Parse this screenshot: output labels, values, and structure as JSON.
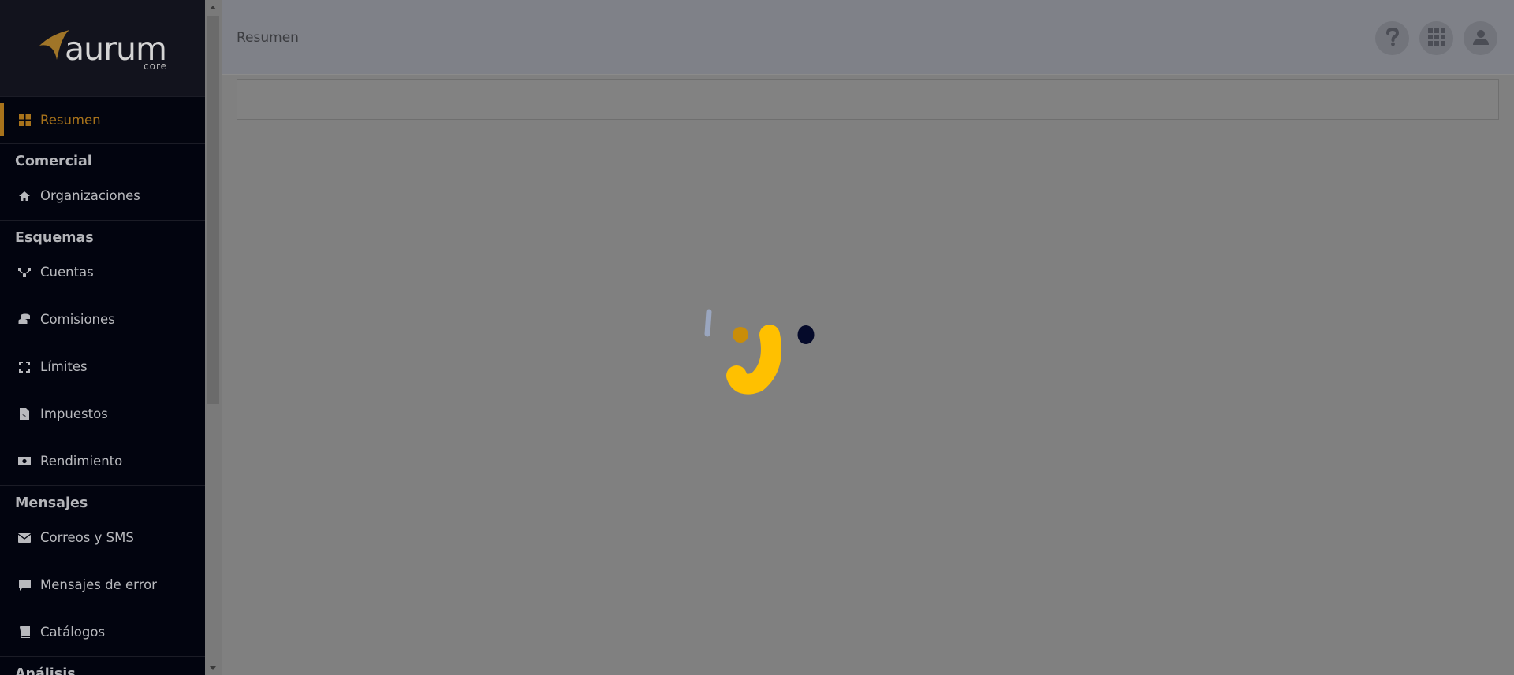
{
  "brand": {
    "name": "aurum",
    "sub": "core"
  },
  "colors": {
    "accent": "#a8731b",
    "sidebar_bg": "#02040f",
    "loader_yellow": "#ffc000",
    "loader_navy": "#050a2a"
  },
  "header": {
    "title": "Resumen"
  },
  "sidebar": {
    "active": {
      "label": "Resumen",
      "icon": "grid-icon"
    },
    "sections": [
      {
        "title": "Comercial",
        "items": [
          {
            "label": "Organizaciones",
            "icon": "home-icon"
          }
        ]
      },
      {
        "title": "Esquemas",
        "items": [
          {
            "label": "Cuentas",
            "icon": "network-icon"
          },
          {
            "label": "Comisiones",
            "icon": "coins-icon"
          },
          {
            "label": "Límites",
            "icon": "expand-icon"
          },
          {
            "label": "Impuestos",
            "icon": "receipt-icon"
          },
          {
            "label": "Rendimiento",
            "icon": "money-icon"
          }
        ]
      },
      {
        "title": "Mensajes",
        "items": [
          {
            "label": "Correos y SMS",
            "icon": "envelope-icon"
          },
          {
            "label": "Mensajes de error",
            "icon": "comment-icon"
          },
          {
            "label": "Catálogos",
            "icon": "book-icon"
          }
        ]
      },
      {
        "title": "Análisis",
        "items": []
      }
    ]
  },
  "header_icons": [
    "help-icon",
    "apps-grid-icon",
    "user-icon"
  ]
}
